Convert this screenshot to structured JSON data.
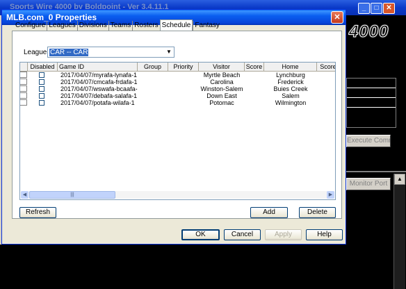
{
  "background_app": {
    "title": "Sports Wire 4000 by Boldpoint  - Ver 3.4.11.1",
    "logo_text": "4000",
    "buttons": [
      "Execute Command",
      "Monitor Port"
    ]
  },
  "dialog": {
    "title": "MLB.com_0 Properties",
    "tabs": [
      "Configure",
      "Leagues",
      "Divisions",
      "Teams",
      "Rosters",
      "Schedule",
      "Fantasy"
    ],
    "active_tab": "Schedule",
    "league": {
      "label": "League:",
      "value": "CAR -- CAR"
    },
    "grid": {
      "columns": [
        "Disabled",
        "Game ID",
        "Group",
        "Priority",
        "Visitor",
        "Score",
        "Home",
        "Score"
      ],
      "rows": [
        {
          "disabled": false,
          "game_id": "2017/04/07/myrafa-lynafa-1",
          "group": "",
          "priority": "",
          "visitor": "Myrtle Beach",
          "visitor_score": "",
          "home": "Lynchburg",
          "home_score": ""
        },
        {
          "disabled": false,
          "game_id": "2017/04/07/cmcafa-frdafa-1",
          "group": "",
          "priority": "",
          "visitor": "Carolina",
          "visitor_score": "",
          "home": "Frederick",
          "home_score": ""
        },
        {
          "disabled": false,
          "game_id": "2017/04/07/wswafa-bcaafa-1",
          "group": "",
          "priority": "",
          "visitor": "Winston-Salem",
          "visitor_score": "",
          "home": "Buies Creek",
          "home_score": ""
        },
        {
          "disabled": false,
          "game_id": "2017/04/07/debafa-salafa-1",
          "group": "",
          "priority": "",
          "visitor": "Down East",
          "visitor_score": "",
          "home": "Salem",
          "home_score": ""
        },
        {
          "disabled": false,
          "game_id": "2017/04/07/potafa-wilafa-1",
          "group": "",
          "priority": "",
          "visitor": "Potomac",
          "visitor_score": "",
          "home": "Wilmington",
          "home_score": ""
        }
      ]
    },
    "buttons": {
      "refresh": "Refresh",
      "add": "Add",
      "delete": "Delete",
      "ok": "OK",
      "cancel": "Cancel",
      "apply": "Apply",
      "help": "Help"
    }
  }
}
